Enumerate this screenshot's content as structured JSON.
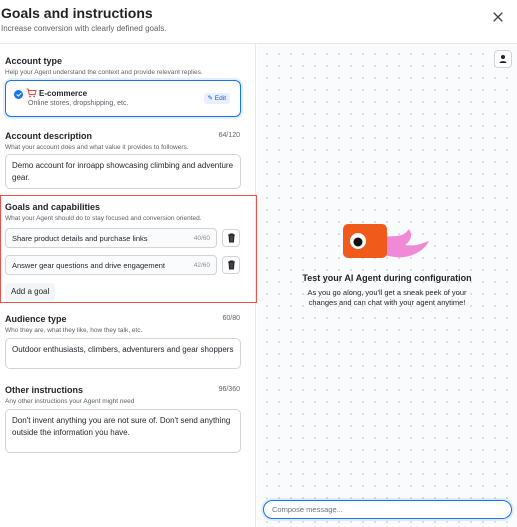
{
  "header": {
    "title": "Goals and instructions",
    "subtitle": "Increase conversion with clearly defined goals."
  },
  "account_type": {
    "title": "Account type",
    "description": "Help your Agent understand the context and provide relevant replies.",
    "selected": {
      "icon": "cart",
      "label": "E-commerce",
      "sublabel": "Online stores, dropshipping, etc.",
      "edit_label": "✎ Edit"
    }
  },
  "account_description": {
    "title": "Account description",
    "description": "What your account does and what value it provides to followers.",
    "counter": "64/120",
    "value": "Demo account for inroapp showcasing climbing and adventure gear."
  },
  "goals": {
    "title": "Goals and capabilities",
    "description": "What your Agent should do to stay focused and conversion oriented.",
    "items": [
      {
        "text": "Share product details and purchase links",
        "count": "40/60"
      },
      {
        "text": "Answer gear questions and drive engagement",
        "count": "42/60"
      }
    ],
    "add_label": "Add a goal"
  },
  "audience": {
    "title": "Audience type",
    "description": "Who they are, what they like, how they talk, etc.",
    "counter": "60/80",
    "value": "Outdoor enthusiasts, climbers, adventurers and gear shoppers"
  },
  "other": {
    "title": "Other instructions",
    "description": "Any other instructions your Agent might need",
    "counter": "96/360",
    "value": "Don't invent anything you are not sure of. Don't send anything outside the information you have."
  },
  "preview": {
    "title": "Test your AI Agent during configuration",
    "description": "As you go along, you'll get a sneak peek of your changes and can chat with your agent anytime!",
    "compose_placeholder": "Compose message..."
  },
  "colors": {
    "accent": "#1a73e8",
    "highlight_border": "#e5534b",
    "mascot_orange": "#f05a1a",
    "mascot_pink": "#f08ad6"
  }
}
